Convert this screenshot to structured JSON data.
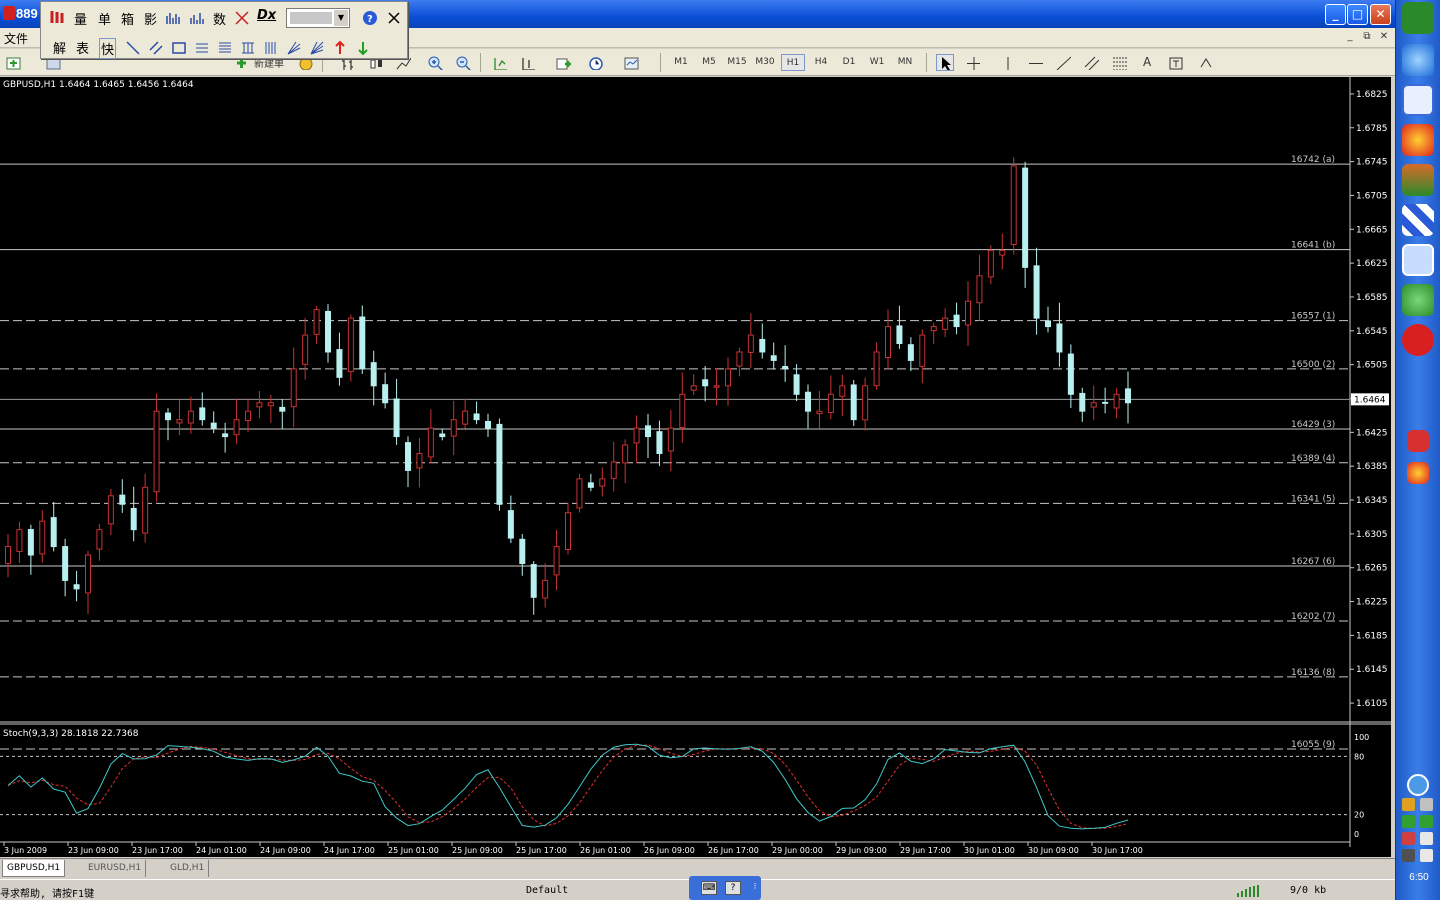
{
  "window": {
    "title": "889",
    "min_label": "_",
    "max_label": "□",
    "close_label": "✕"
  },
  "menubar": {
    "file_label": "文件",
    "restore_label": "⧉",
    "close_label": "✕"
  },
  "float_toolbar": {
    "row1": [
      "量",
      "单",
      "箱",
      "影",
      "数"
    ],
    "row2": [
      "解",
      "表",
      "快"
    ],
    "dx_label": "Dx"
  },
  "toolbar": {
    "new_order_label": "新建单",
    "timeframes": [
      "M1",
      "M5",
      "M15",
      "M30",
      "H1",
      "H4",
      "D1",
      "W1",
      "MN"
    ],
    "active_timeframe": "H1",
    "text_tool_label": "A"
  },
  "chart": {
    "symbol_info": "GBPUSD,H1  1.6464 1.6465 1.6456 1.6464",
    "current_price": "1.6464",
    "stoch_info": "Stoch(9,3,3) 28.1818 22.7368",
    "price_axis_labels": [
      "1.6825",
      "1.6785",
      "1.6745",
      "1.6705",
      "1.6665",
      "1.6625",
      "1.6585",
      "1.6545",
      "1.6505",
      "1.6465",
      "1.6425",
      "1.6385",
      "1.6345",
      "1.6305",
      "1.6265",
      "1.6225",
      "1.6185",
      "1.6145",
      "1.6105"
    ],
    "stoch_axis_labels": [
      "100",
      "80",
      "20",
      "0"
    ],
    "fib_levels": [
      {
        "label": "16742 (a)",
        "style": "solid"
      },
      {
        "label": "16641 (b)",
        "style": "solid"
      },
      {
        "label": "16557 (1)",
        "style": "dashed"
      },
      {
        "label": "16500 (2)",
        "style": "dashed"
      },
      {
        "label": "16429 (3)",
        "style": "solid"
      },
      {
        "label": "16389 (4)",
        "style": "dashed"
      },
      {
        "label": "16341 (5)",
        "style": "dashed"
      },
      {
        "label": "16267 (6)",
        "style": "solid"
      },
      {
        "label": "16202 (7)",
        "style": "dashed"
      },
      {
        "label": "16136 (8)",
        "style": "dashed"
      },
      {
        "label": "16055 (9)",
        "style": "dashed"
      }
    ],
    "time_axis_labels": [
      "3 Jun 2009",
      "23 Jun 09:00",
      "23 Jun 17:00",
      "24 Jun 01:00",
      "24 Jun 09:00",
      "24 Jun 17:00",
      "25 Jun 01:00",
      "25 Jun 09:00",
      "25 Jun 17:00",
      "26 Jun 01:00",
      "26 Jun 09:00",
      "26 Jun 17:00",
      "29 Jun 00:00",
      "29 Jun 09:00",
      "29 Jun 17:00",
      "30 Jun 01:00",
      "30 Jun 09:00",
      "30 Jun 17:00"
    ],
    "colors": {
      "background": "#000000",
      "bull_candle": "#c83232",
      "bear_candle": "#b8f0f0",
      "stoch_main": "#40c8c8",
      "stoch_signal": "#e03030",
      "grid_line": "#c8c8c8"
    }
  },
  "chart_data": {
    "type": "candlestick",
    "symbol": "GBPUSD",
    "timeframe": "H1",
    "ylim": [
      1.6085,
      1.6845
    ],
    "close_series_approx": [
      1.629,
      1.631,
      1.628,
      1.632,
      1.629,
      1.625,
      1.624,
      1.628,
      1.631,
      1.635,
      1.634,
      1.631,
      1.636,
      1.645,
      1.644,
      1.644,
      1.645,
      1.644,
      1.643,
      1.642,
      1.644,
      1.645,
      1.646,
      1.646,
      1.645,
      1.65,
      1.654,
      1.657,
      1.652,
      1.649,
      1.656,
      1.65,
      1.648,
      1.646,
      1.642,
      1.638,
      1.64,
      1.643,
      1.642,
      1.644,
      1.645,
      1.644,
      1.643,
      1.634,
      1.63,
      1.627,
      1.623,
      1.625,
      1.629,
      1.633,
      1.637,
      1.636,
      1.637,
      1.639,
      1.641,
      1.643,
      1.642,
      1.64,
      1.643,
      1.647,
      1.648,
      1.648,
      1.648,
      1.65,
      1.652,
      1.654,
      1.652,
      1.651,
      1.65,
      1.647,
      1.645,
      1.645,
      1.647,
      1.648,
      1.644,
      1.648,
      1.652,
      1.655,
      1.653,
      1.651,
      1.654,
      1.655,
      1.656,
      1.655,
      1.658,
      1.661,
      1.664,
      1.664,
      1.674,
      1.662,
      1.656,
      1.655,
      1.652,
      1.647,
      1.645,
      1.646,
      1.646,
      1.647,
      1.646
    ],
    "stochastic": {
      "k": 28.1818,
      "d": 22.7368,
      "params": "9,3,3",
      "levels": [
        80,
        20
      ]
    }
  },
  "tabs": [
    "GBPUSD,H1",
    "EURUSD,H1",
    "GLD,H1"
  ],
  "status": {
    "help_text": "寻求帮助, 请按F1键",
    "profile": "Default",
    "traffic": "9/0 kb"
  },
  "tray": {
    "clock": "6:50"
  }
}
